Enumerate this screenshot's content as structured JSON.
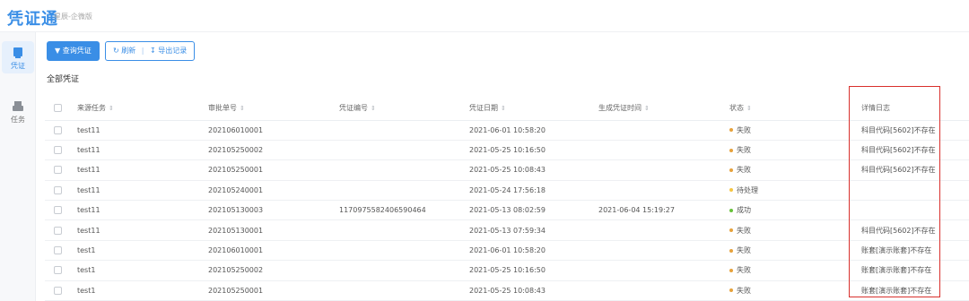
{
  "app": {
    "title": "凭证通",
    "subtitle": "星辰-企微版"
  },
  "sidebar": {
    "items": [
      {
        "label": "凭证",
        "icon": "voucher-icon",
        "active": true
      },
      {
        "label": "任务",
        "icon": "task-icon",
        "active": false
      }
    ]
  },
  "toolbar": {
    "query_label": "查询凭证",
    "refresh_label": "刷新",
    "separator": "|",
    "export_label": "导出记录"
  },
  "section": {
    "title": "全部凭证"
  },
  "table": {
    "columns": [
      "来源任务",
      "审批单号",
      "凭证编号",
      "凭证日期",
      "生成凭证时间",
      "状态",
      "详情日志"
    ],
    "rows": [
      {
        "task": "test11",
        "approval": "202106010001",
        "voucher": "",
        "date": "2021-06-01 10:58:20",
        "generated": "",
        "status": "失败",
        "status_color": "#e6a23c",
        "log": "科目代码[5602]不存在"
      },
      {
        "task": "test11",
        "approval": "202105250002",
        "voucher": "",
        "date": "2021-05-25 10:16:50",
        "generated": "",
        "status": "失败",
        "status_color": "#e6a23c",
        "log": "科目代码[5602]不存在"
      },
      {
        "task": "test11",
        "approval": "202105250001",
        "voucher": "",
        "date": "2021-05-25 10:08:43",
        "generated": "",
        "status": "失败",
        "status_color": "#e6a23c",
        "log": "科目代码[5602]不存在"
      },
      {
        "task": "test11",
        "approval": "202105240001",
        "voucher": "",
        "date": "2021-05-24 17:56:18",
        "generated": "",
        "status": "待处理",
        "status_color": "#f5c542",
        "log": ""
      },
      {
        "task": "test11",
        "approval": "202105130003",
        "voucher": "1170975582406590464",
        "date": "2021-05-13 08:02:59",
        "generated": "2021-06-04 15:19:27",
        "status": "成功",
        "status_color": "#67c23a",
        "log": ""
      },
      {
        "task": "test11",
        "approval": "202105130001",
        "voucher": "",
        "date": "2021-05-13 07:59:34",
        "generated": "",
        "status": "失败",
        "status_color": "#e6a23c",
        "log": "科目代码[5602]不存在"
      },
      {
        "task": "test1",
        "approval": "202106010001",
        "voucher": "",
        "date": "2021-06-01 10:58:20",
        "generated": "",
        "status": "失败",
        "status_color": "#e6a23c",
        "log": "账套[演示账套]不存在"
      },
      {
        "task": "test1",
        "approval": "202105250002",
        "voucher": "",
        "date": "2021-05-25 10:16:50",
        "generated": "",
        "status": "失败",
        "status_color": "#e6a23c",
        "log": "账套[演示账套]不存在"
      },
      {
        "task": "test1",
        "approval": "202105250001",
        "voucher": "",
        "date": "2021-05-25 10:08:43",
        "generated": "",
        "status": "失败",
        "status_color": "#e6a23c",
        "log": "账套[演示账套]不存在"
      }
    ]
  },
  "colors": {
    "accent": "#3a8ee6",
    "highlight_box": "#d9302c"
  }
}
